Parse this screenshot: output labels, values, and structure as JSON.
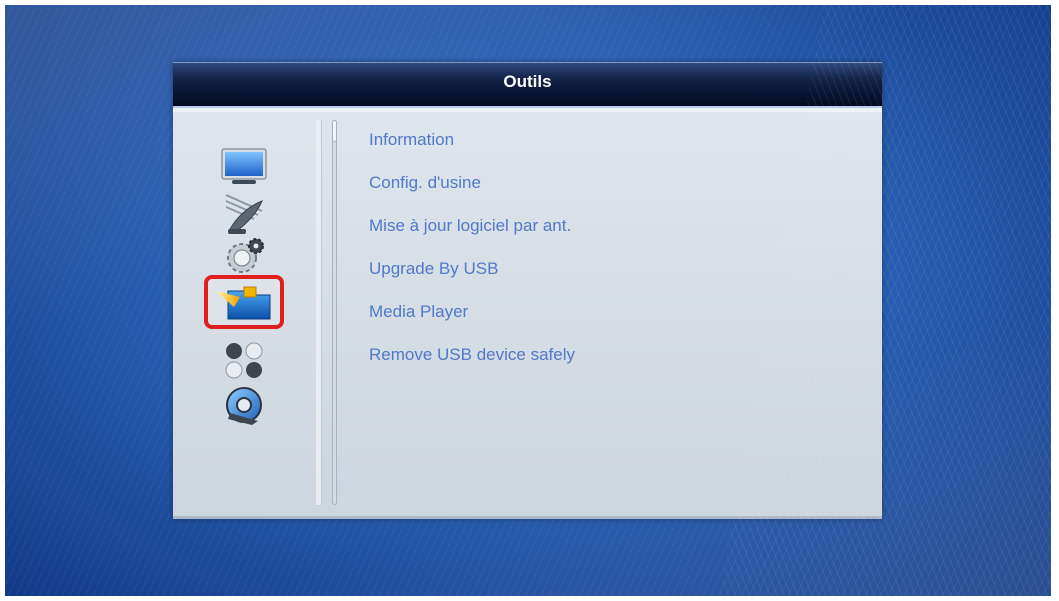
{
  "window": {
    "title": "Outils"
  },
  "sidebar": {
    "items": [
      {
        "icon": "tv-monitor-icon",
        "selected": false
      },
      {
        "icon": "satellite-dish-icon",
        "selected": false
      },
      {
        "icon": "gear-settings-icon",
        "selected": false
      },
      {
        "icon": "folder-tools-icon",
        "selected": true
      },
      {
        "icon": "game-balls-icon",
        "selected": false
      },
      {
        "icon": "media-disc-icon",
        "selected": false
      }
    ]
  },
  "menu": {
    "items": [
      {
        "label": "Information"
      },
      {
        "label": "Config. d'usine"
      },
      {
        "label": "Mise à jour logiciel par ant."
      },
      {
        "label": "Upgrade By USB"
      },
      {
        "label": "Media Player"
      },
      {
        "label": "Remove USB device safely"
      }
    ]
  },
  "colors": {
    "highlight_border": "#e01e1e",
    "menu_text": "#4f79c9",
    "title_bar": "#0a1632",
    "panel": "#d6dde5"
  }
}
